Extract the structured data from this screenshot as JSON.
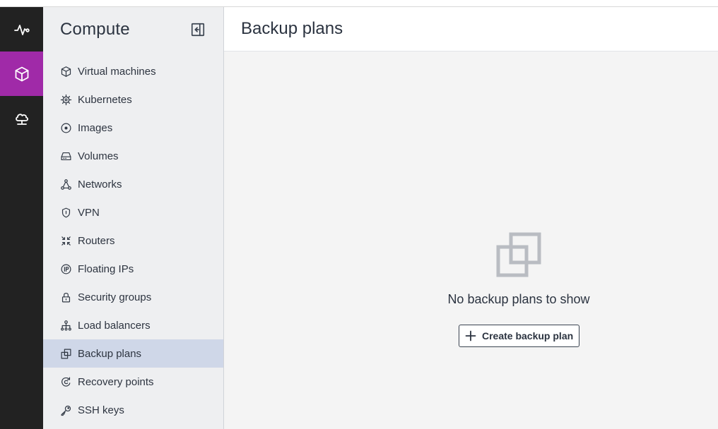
{
  "rail": {
    "items": [
      {
        "icon": "activity-icon",
        "active": false
      },
      {
        "icon": "cube-icon",
        "active": true
      },
      {
        "icon": "cloud-network-icon",
        "active": false
      }
    ],
    "accent_color": "#a02aa8"
  },
  "sidebar": {
    "title": "Compute",
    "items": [
      {
        "label": "Virtual machines",
        "icon": "cube-icon"
      },
      {
        "label": "Kubernetes",
        "icon": "helm-wheel-icon"
      },
      {
        "label": "Images",
        "icon": "disc-icon"
      },
      {
        "label": "Volumes",
        "icon": "hard-drive-icon"
      },
      {
        "label": "Networks",
        "icon": "network-icon"
      },
      {
        "label": "VPN",
        "icon": "shield-icon"
      },
      {
        "label": "Routers",
        "icon": "router-icon"
      },
      {
        "label": "Floating IPs",
        "icon": "floating-ip-icon"
      },
      {
        "label": "Security groups",
        "icon": "lock-icon"
      },
      {
        "label": "Load balancers",
        "icon": "hierarchy-icon"
      },
      {
        "label": "Backup plans",
        "icon": "backup-icon",
        "active": true
      },
      {
        "label": "Recovery points",
        "icon": "recovery-icon"
      },
      {
        "label": "SSH keys",
        "icon": "key-icon"
      }
    ],
    "active_color": "#cfd7e8"
  },
  "main": {
    "title": "Backup plans",
    "empty_state": {
      "icon": "backup-plans-empty-icon",
      "message": "No backup plans to show",
      "button_label": "Create backup plan"
    }
  }
}
